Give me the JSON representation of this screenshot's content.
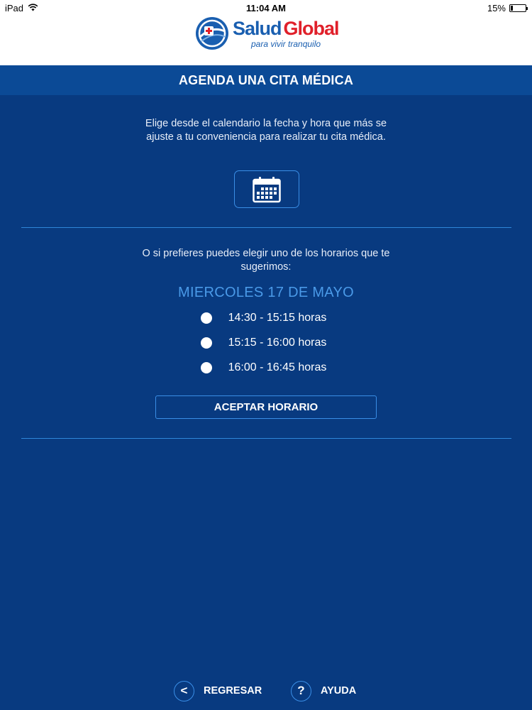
{
  "status_bar": {
    "device": "iPad",
    "time": "11:04 AM",
    "battery": "15%",
    "battery_level": 0.15
  },
  "header": {
    "brand_part1": "Salud",
    "brand_part2": "Global",
    "tagline": "para vivir tranquilo"
  },
  "title": "AGENDA UNA CITA MÉDICA",
  "intro_text": "Elige desde el calendario la fecha y hora que más se ajuste a tu conveniencia para realizar tu cita médica.",
  "calendar_button_icon": "calendar-icon",
  "suggestion_text": "O si prefieres puedes elegir uno de los horarios que te sugerimos:",
  "suggested_date": "MIERCOLES 17 DE MAYO",
  "time_slots": [
    {
      "label": "14:30 - 15:15 horas",
      "selected": false
    },
    {
      "label": "15:15 - 16:00 horas",
      "selected": false
    },
    {
      "label": "16:00 - 16:45 horas",
      "selected": false
    }
  ],
  "accept_button": "ACEPTAR HORARIO",
  "footer": {
    "back_label": "REGRESAR",
    "back_icon": "<",
    "help_label": "AYUDA",
    "help_icon": "?"
  },
  "colors": {
    "background": "#083a80",
    "title_bar": "#0b4a96",
    "accent": "#4a9ae8",
    "border": "#3a8ee6",
    "brand_blue": "#1a5fb0",
    "brand_red": "#e0202a"
  }
}
